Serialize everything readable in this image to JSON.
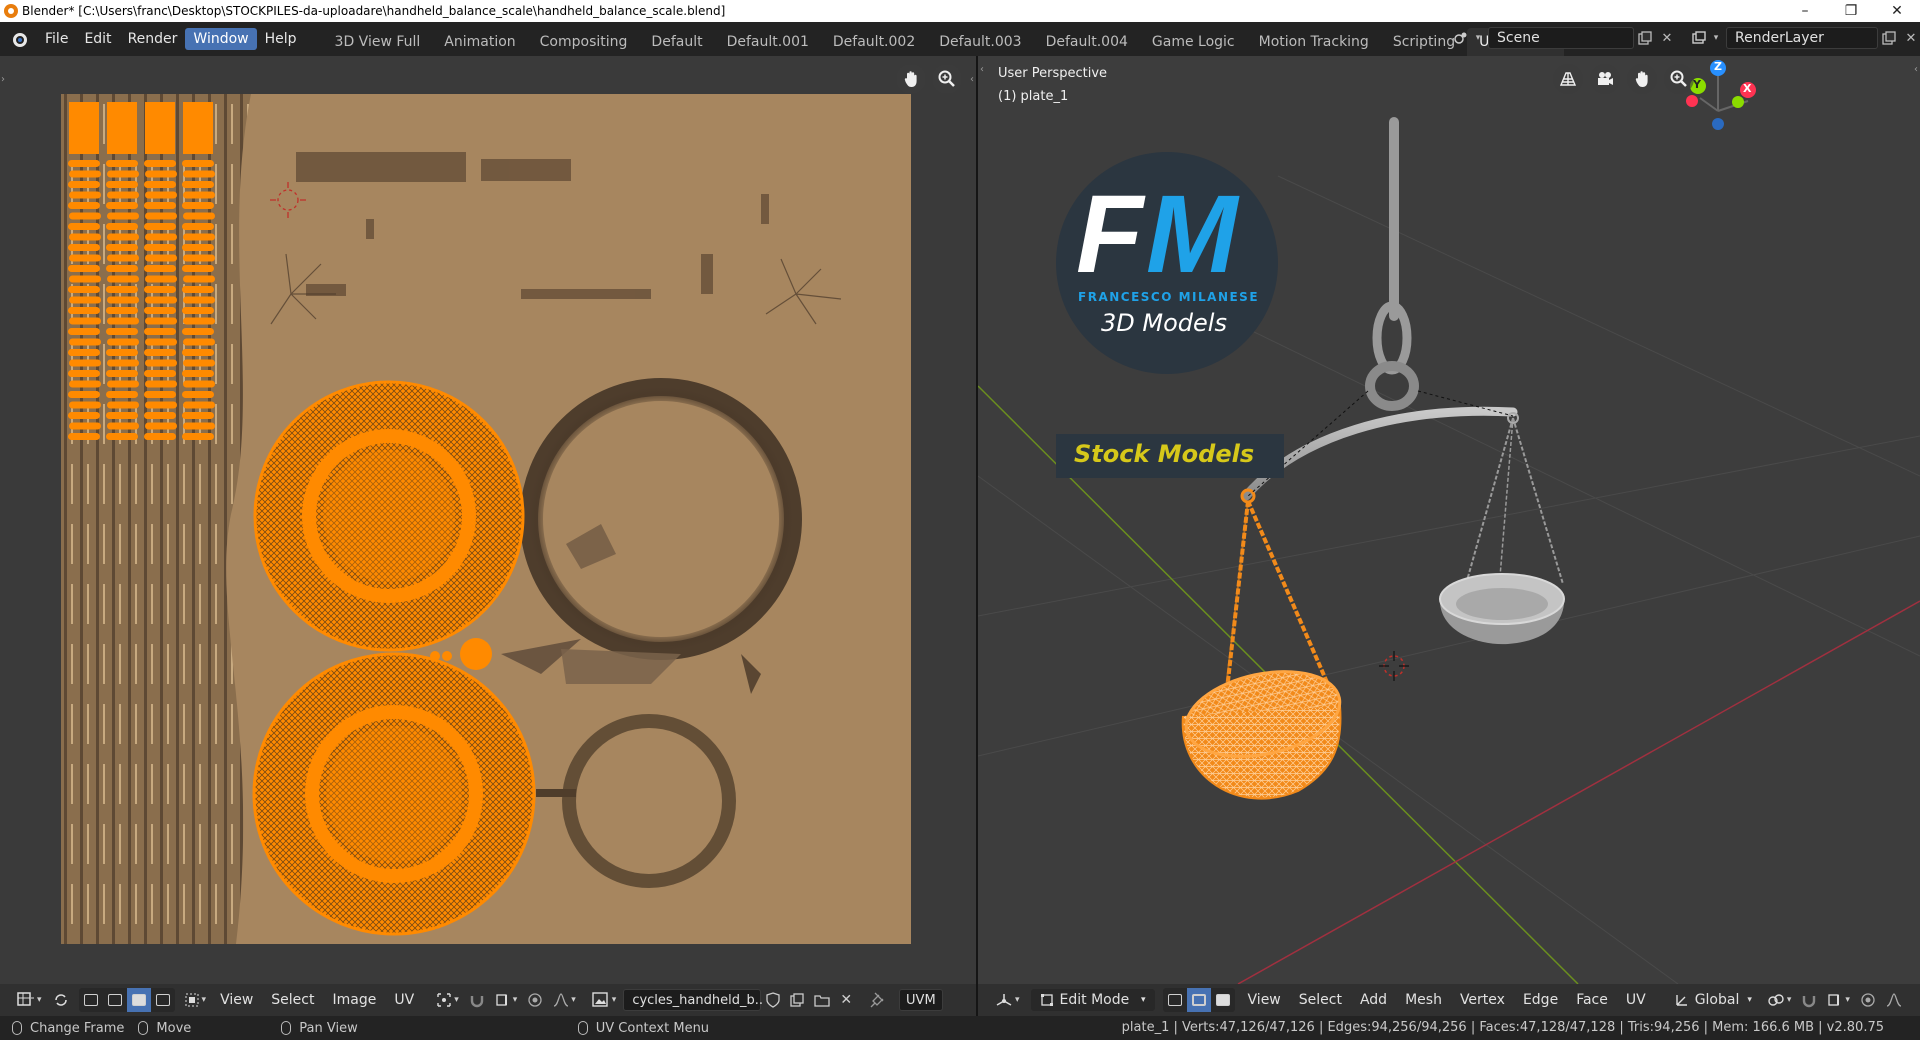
{
  "window": {
    "title": "Blender* [C:\\Users\\franc\\Desktop\\STOCKPILES-da-uploadare\\handheld_balance_scale\\handheld_balance_scale.blend]",
    "minimize": "–",
    "maximize": "❐",
    "close": "✕"
  },
  "menu": {
    "items": [
      "File",
      "Edit",
      "Render",
      "Window",
      "Help"
    ],
    "active": "Window"
  },
  "workspaces": {
    "tabs": [
      "3D View Full",
      "Animation",
      "Compositing",
      "Default",
      "Default.001",
      "Default.002",
      "Default.003",
      "Default.004",
      "Game Logic",
      "Motion Tracking",
      "Scripting",
      "UV Editing"
    ],
    "active": "UV Editing"
  },
  "scene": {
    "name": "Scene",
    "render_layer": "RenderLayer"
  },
  "uv_editor": {
    "header": {
      "menus": [
        "View",
        "Select",
        "Image",
        "UV"
      ],
      "image_name": "cycles_handheld_b..",
      "uv_map": "UVM"
    }
  },
  "viewport": {
    "perspective_label": "User Perspective",
    "object_label": "(1) plate_1",
    "header": {
      "mode": "Edit Mode",
      "menus": [
        "View",
        "Select",
        "Add",
        "Mesh",
        "Vertex",
        "Edge",
        "Face",
        "UV"
      ],
      "orientation": "Global"
    },
    "gizmo_axes": {
      "z": "Z",
      "y": "Y",
      "x": "X"
    },
    "logo": {
      "monogram_f": "F",
      "monogram_m": "M",
      "name": "FRANCESCO MILANESE",
      "tagline": "3D Models",
      "banner": "Stock Models"
    }
  },
  "status": {
    "hints": [
      "Change Frame",
      "Move",
      "Pan View",
      "UV Context Menu"
    ],
    "stats": "plate_1 | Verts:47,126/47,126 | Edges:94,256/94,256 | Faces:47,128/47,128 | Tris:94,256 | Mem: 166.6 MB | v2.80.75"
  },
  "colors": {
    "accent": "#4772b3",
    "selection": "#ff8a00",
    "texture_base": "#a7865f",
    "axis_x": "#ff3352",
    "axis_y": "#8bdc00",
    "axis_z": "#2890ff"
  }
}
